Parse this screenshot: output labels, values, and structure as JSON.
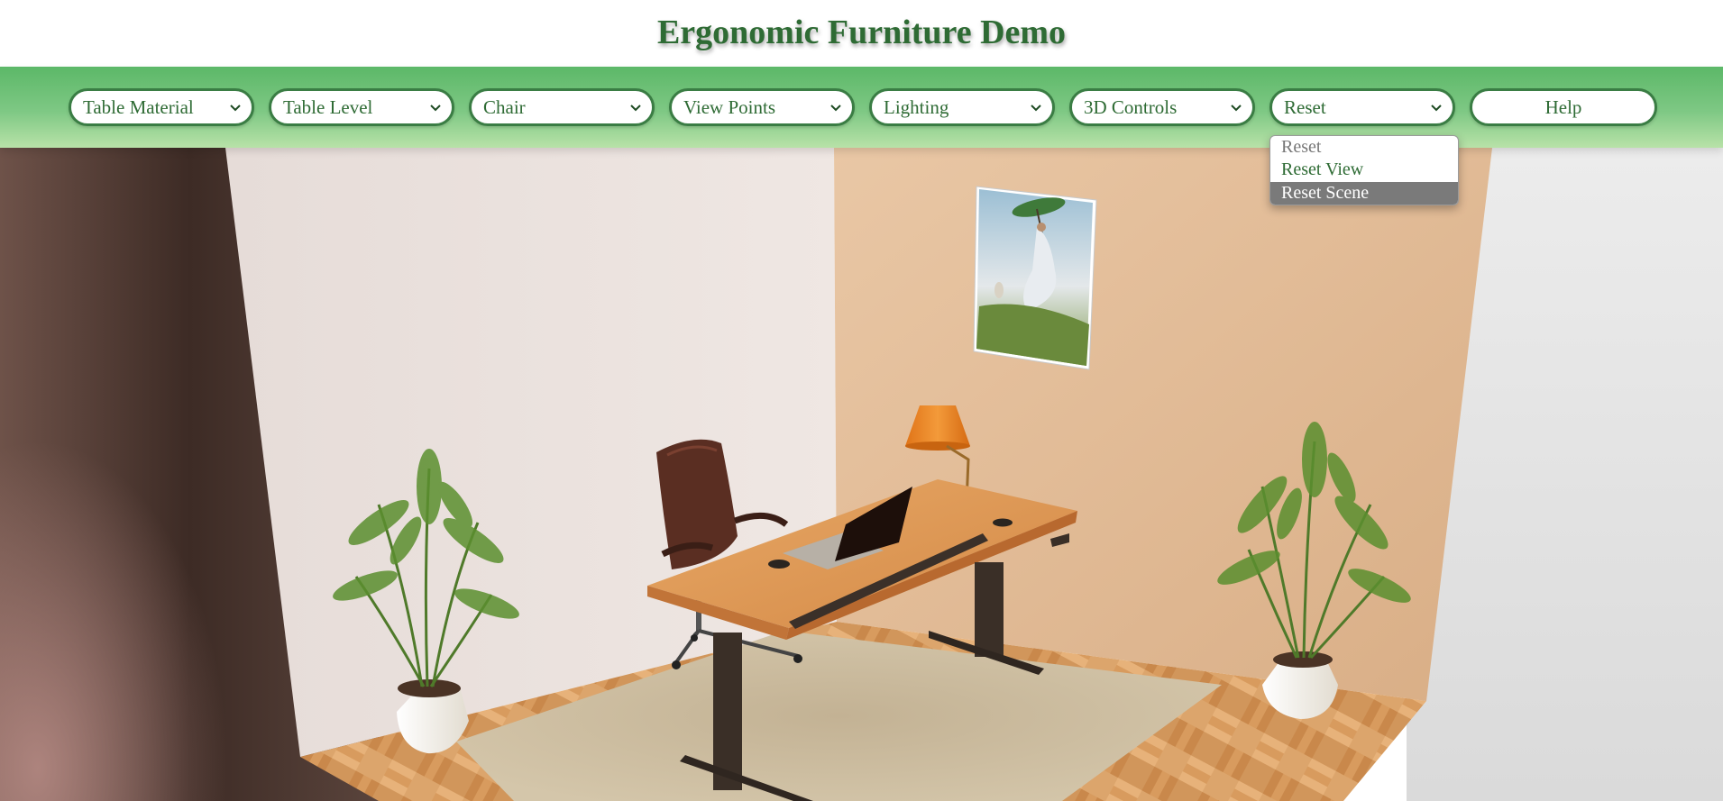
{
  "page": {
    "title": "Ergonomic Furniture Demo"
  },
  "toolbar": {
    "selects": [
      {
        "label": "Table Material"
      },
      {
        "label": "Table Level"
      },
      {
        "label": "Chair"
      },
      {
        "label": "View Points"
      },
      {
        "label": "Lighting"
      },
      {
        "label": "3D Controls"
      },
      {
        "label": "Reset"
      }
    ],
    "help_label": "Help"
  },
  "reset_dropdown": {
    "options": [
      {
        "label": "Reset",
        "state": "disabled"
      },
      {
        "label": "Reset View",
        "state": "normal"
      },
      {
        "label": "Reset Scene",
        "state": "highlighted"
      }
    ]
  },
  "colors": {
    "title": "#2e6b34",
    "toolbar_top": "#5cb868",
    "toolbar_bottom": "#b8e2a8",
    "control_border": "#3a7d44",
    "highlight": "#7a7a7a"
  },
  "scene": {
    "objects": [
      "left-wall",
      "back-wall",
      "parquet-floor",
      "rug",
      "standing-desk",
      "laptop",
      "desk-lamp",
      "office-chair",
      "painting",
      "plant-left",
      "plant-right"
    ]
  }
}
